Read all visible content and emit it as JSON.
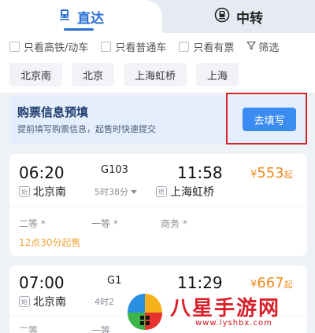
{
  "tabs": {
    "direct_label": "直达",
    "transfer_label": "中转",
    "direct_icon": "train-icon",
    "transfer_icon": "transfer-train-icon"
  },
  "filters": {
    "checkboxes": [
      "只看高铁/动车",
      "只看普通车",
      "只看有票"
    ],
    "filter_label": "筛选",
    "stations": [
      "北京南",
      "北京",
      "上海虹桥",
      "上海"
    ]
  },
  "prefill": {
    "title": "购票信息预填",
    "desc": "提前填写购票信息，起售时快速提交",
    "button": "去填写"
  },
  "trains": [
    {
      "depart_time": "06:20",
      "train_no": "G103",
      "duration": "5时38分",
      "arrive_time": "11:58",
      "from_tag": "始",
      "from": "北京南",
      "to_tag": "终",
      "to": "上海虹桥",
      "price_symbol": "¥",
      "price": "553",
      "price_suffix": "起",
      "seats": [
        "二等 *",
        "一等 *",
        "商务 *"
      ],
      "sale_note": "12点30分起售"
    },
    {
      "depart_time": "07:00",
      "train_no": "G1",
      "duration": "4时2",
      "arrive_time": "11:29",
      "from_tag": "始",
      "from": "北京南",
      "price_symbol": "¥",
      "price": "667",
      "price_suffix": "起",
      "seats": [
        "二等",
        "一等"
      ]
    }
  ],
  "watermark": {
    "brand": "八星手游网",
    "url": "www.lyshbx.com"
  },
  "colors": {
    "accent": "#2a6fd6",
    "button": "#3b8cf0",
    "price": "#f08a1c",
    "highlight": "#d6262a",
    "watermark": "#d8212a"
  }
}
